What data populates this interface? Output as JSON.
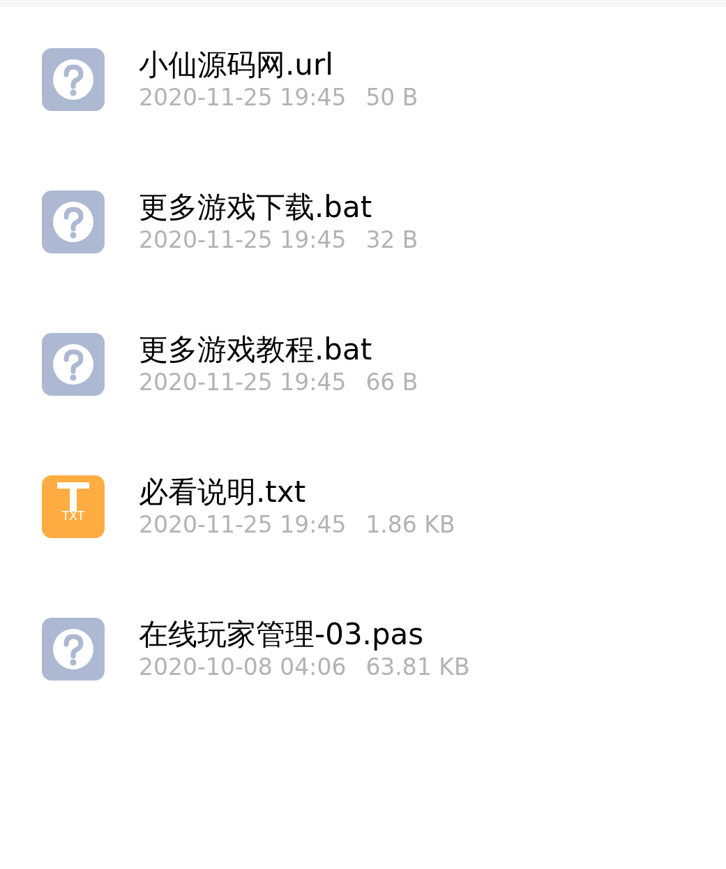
{
  "files": [
    {
      "kind": "unknown",
      "name": "小仙源码网.url",
      "date": "2020-11-25 19:45",
      "size": "50 B"
    },
    {
      "kind": "unknown",
      "name": "更多游戏下载.bat",
      "date": "2020-11-25 19:45",
      "size": "32 B"
    },
    {
      "kind": "unknown",
      "name": "更多游戏教程.bat",
      "date": "2020-11-25 19:45",
      "size": "66 B"
    },
    {
      "kind": "txt",
      "name": "必看说明.txt",
      "date": "2020-11-25 19:45",
      "size": "1.86 KB",
      "icon_label": "TXT"
    },
    {
      "kind": "unknown",
      "name": "在线玩家管理-03.pas",
      "date": "2020-10-08 04:06",
      "size": "63.81 KB"
    }
  ]
}
